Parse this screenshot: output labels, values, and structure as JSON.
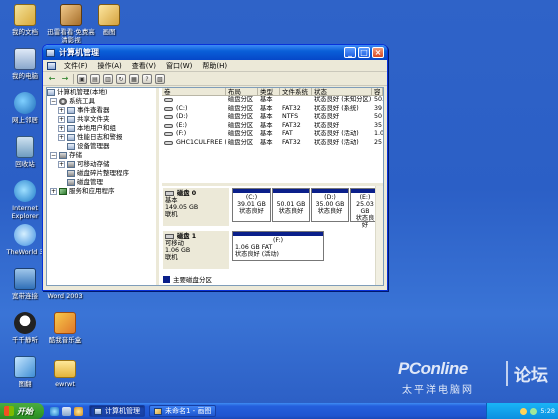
{
  "desktop": {
    "icons": [
      {
        "label": "我的文档"
      },
      {
        "label": "迅雷看看·免费高清影视"
      },
      {
        "label": "画图"
      },
      {
        "label": "我的电脑"
      },
      {
        "label": "网上邻居"
      },
      {
        "label": "回收站"
      },
      {
        "label": "Internet Explorer"
      },
      {
        "label": "TheWorld 3"
      },
      {
        "label": "宽带连接"
      },
      {
        "label": "Word 2003"
      },
      {
        "label": "千千静听"
      },
      {
        "label": "酷我音乐盒"
      },
      {
        "label": "图翻"
      },
      {
        "label": "ewrwt"
      }
    ]
  },
  "window": {
    "title": "计算机管理",
    "buttons": {
      "minimize": "_",
      "maximize": "□",
      "close": "×"
    },
    "menu": [
      "文件(F)",
      "操作(A)",
      "查看(V)",
      "窗口(W)",
      "帮助(H)"
    ],
    "tree": [
      {
        "label": "计算机管理(本地)",
        "level": 0,
        "expander": ""
      },
      {
        "label": "系统工具",
        "level": 1,
        "expander": "−"
      },
      {
        "label": "事件查看器",
        "level": 2,
        "expander": "+"
      },
      {
        "label": "共享文件夹",
        "level": 2,
        "expander": "+"
      },
      {
        "label": "本地用户和组",
        "level": 2,
        "expander": "+"
      },
      {
        "label": "性能日志和警报",
        "level": 2,
        "expander": "+"
      },
      {
        "label": "设备管理器",
        "level": 2,
        "expander": ""
      },
      {
        "label": "存储",
        "level": 1,
        "expander": "−"
      },
      {
        "label": "可移动存储",
        "level": 2,
        "expander": "+"
      },
      {
        "label": "磁盘碎片整理程序",
        "level": 2,
        "expander": ""
      },
      {
        "label": "磁盘管理",
        "level": 2,
        "expander": ""
      },
      {
        "label": "服务和应用程序",
        "level": 1,
        "expander": "+"
      }
    ],
    "volume_table": {
      "headers": [
        "卷",
        "布局",
        "类型",
        "文件系统",
        "状态",
        "容"
      ],
      "rows": [
        {
          "vol": "",
          "layout": "磁盘分区",
          "type": "基本",
          "fs": "",
          "status": "状态良好 (未知分区)",
          "cap": "50."
        },
        {
          "vol": "(C:)",
          "layout": "磁盘分区",
          "type": "基本",
          "fs": "FAT32",
          "status": "状态良好 (系统)",
          "cap": "39"
        },
        {
          "vol": "(D:)",
          "layout": "磁盘分区",
          "type": "基本",
          "fs": "NTFS",
          "status": "状态良好",
          "cap": "50"
        },
        {
          "vol": "(E:)",
          "layout": "磁盘分区",
          "type": "基本",
          "fs": "FAT32",
          "status": "状态良好",
          "cap": "35"
        },
        {
          "vol": "(F:)",
          "layout": "磁盘分区",
          "type": "基本",
          "fs": "FAT",
          "status": "状态良好 (活动)",
          "cap": "1.0"
        },
        {
          "vol": "GHC1CULFREE (G:)",
          "layout": "磁盘分区",
          "type": "基本",
          "fs": "FAT32",
          "status": "状态良好 (活动)",
          "cap": "25"
        }
      ]
    },
    "disks": [
      {
        "name": "磁盘 0",
        "kind": "基本",
        "size": "149.05 GB",
        "state": "联机",
        "partitions": [
          {
            "title": "(C:)",
            "size": "39.01 GB",
            "status": "状态良好"
          },
          {
            "title": "",
            "size": "50.01 GB",
            "status": "状态良好"
          },
          {
            "title": "(D:)",
            "size": "35.00 GB",
            "status": "状态良好"
          },
          {
            "title": "(E:)",
            "size": "25.03 GB",
            "status": "状态良好"
          }
        ]
      },
      {
        "name": "磁盘 1",
        "kind": "可移动",
        "size": "1.06 GB",
        "state": "联机",
        "partitions": [
          {
            "title": "(F:)",
            "size": "1.06 GB FAT",
            "status": "状态良好 (活动)"
          }
        ]
      }
    ],
    "legend": "主要磁盘分区"
  },
  "taskbar": {
    "start_label": "开始",
    "tasks": [
      {
        "label": "计算机管理",
        "active": true
      },
      {
        "label": "未命名1 - 画图",
        "active": false
      }
    ],
    "clock": "5:28"
  },
  "watermark": {
    "brand": "PConline",
    "tagline": "太平洋电脑网",
    "right": "论坛"
  },
  "colors": {
    "desktop": "#2f63c8",
    "titlebar": "#0a5fd8",
    "primary_partition": "#0a1f8a",
    "start": "#38a02e"
  }
}
